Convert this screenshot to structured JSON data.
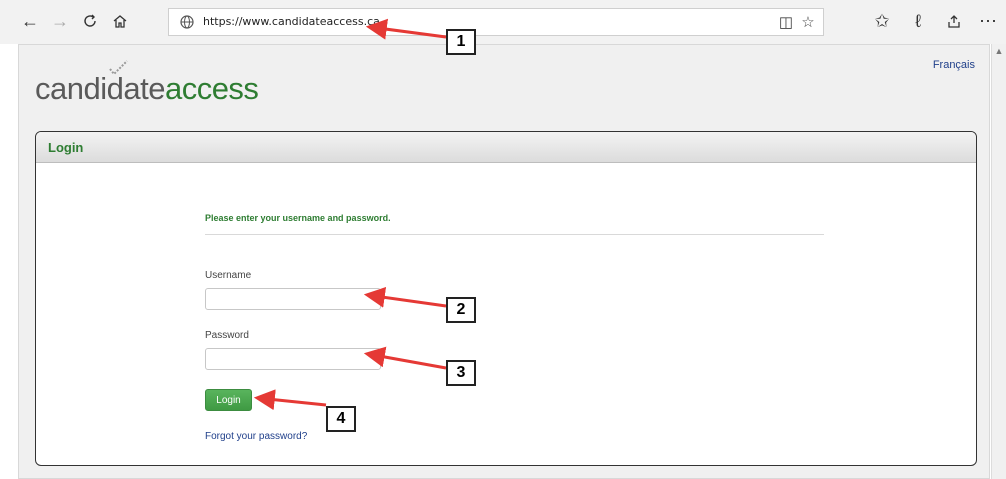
{
  "browser": {
    "url": "https://www.candidateaccess.ca"
  },
  "page": {
    "logo": {
      "part1": "candidate",
      "part2": "access"
    },
    "language_link": "Français",
    "panel_title": "Login",
    "instruction": "Please enter your username and password.",
    "username_label": "Username",
    "password_label": "Password",
    "login_button": "Login",
    "forgot_link": "Forgot your password?"
  },
  "callouts": [
    "1",
    "2",
    "3",
    "4"
  ],
  "colors": {
    "brand_green": "#2e7d32",
    "button_green": "#4caf50",
    "link_blue": "#1f3f8a",
    "arrow_red": "#e53935"
  }
}
